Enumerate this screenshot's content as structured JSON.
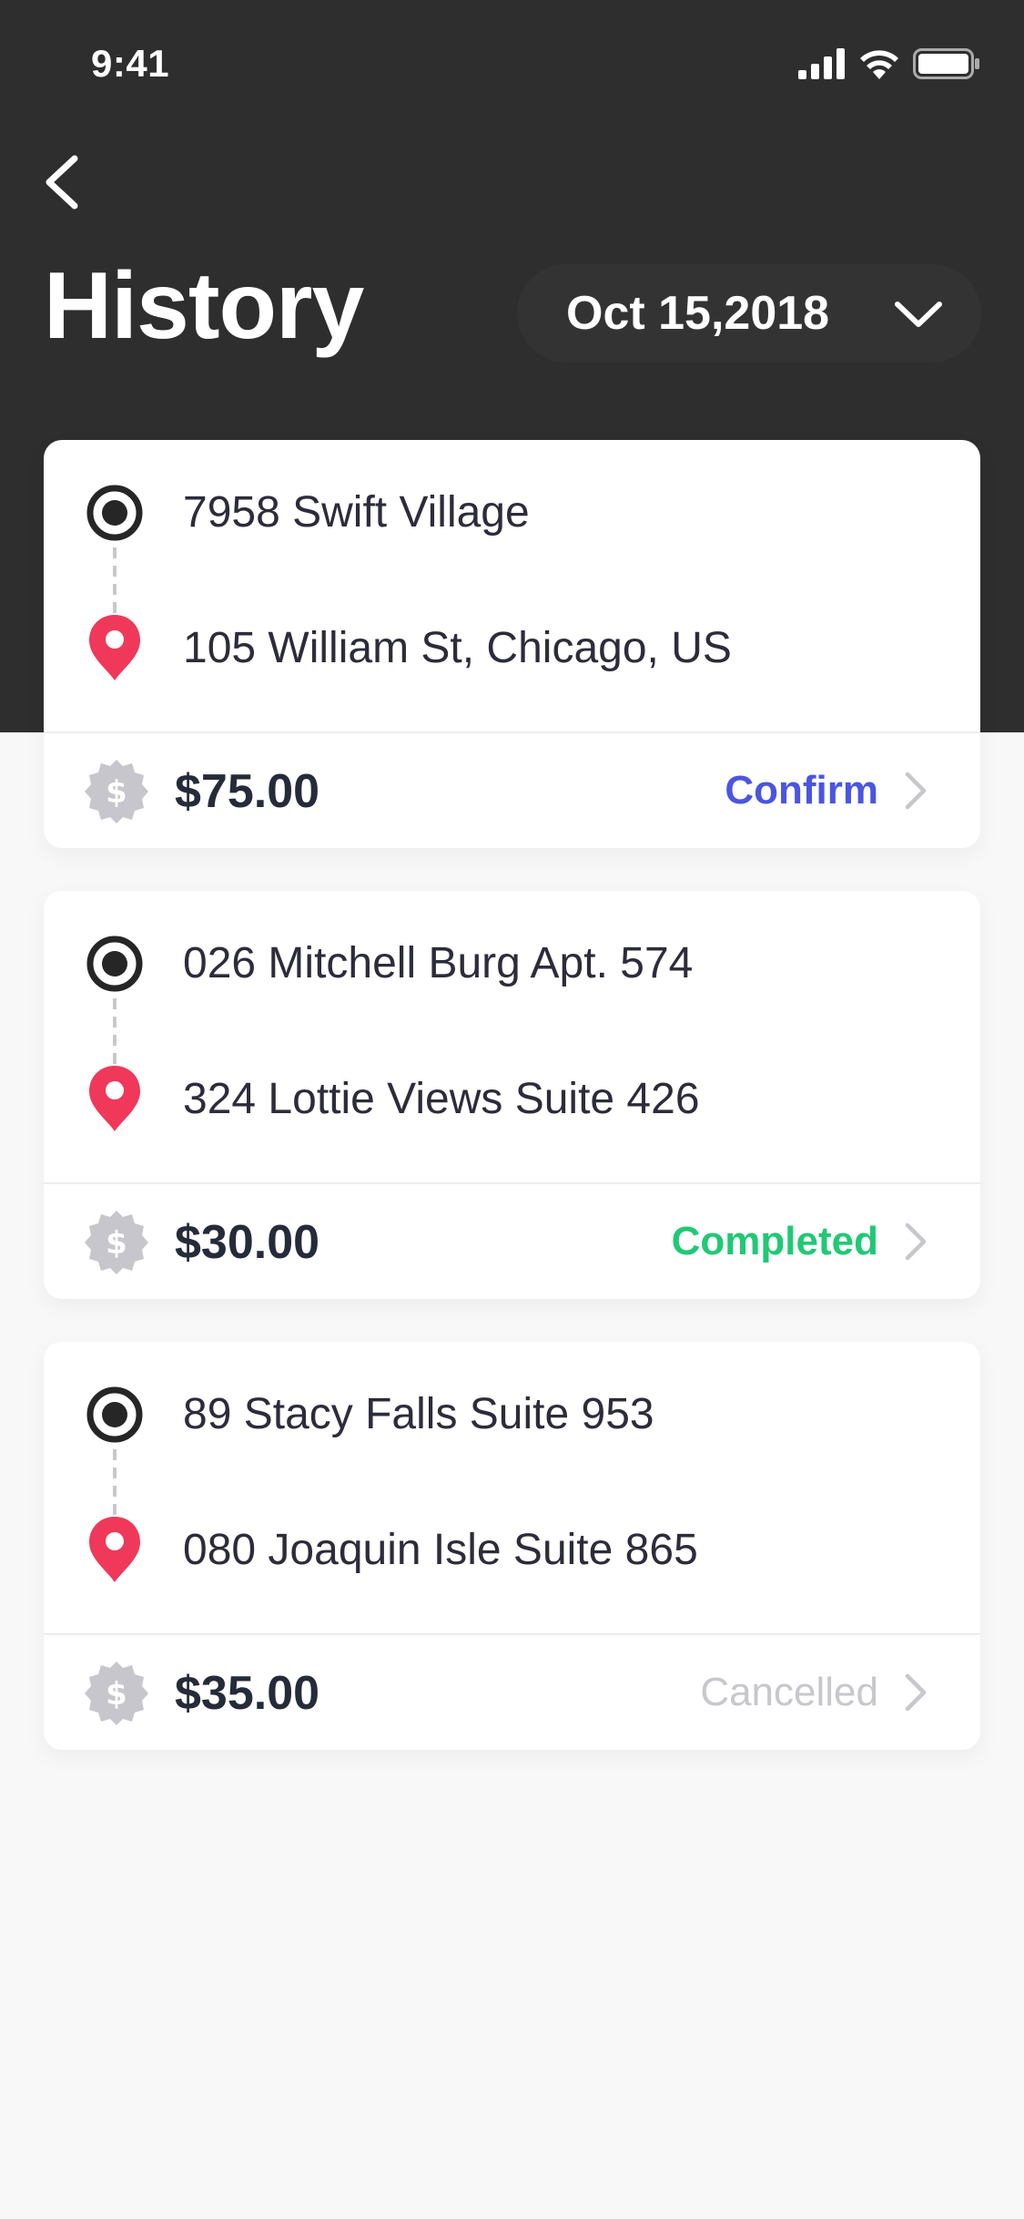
{
  "status_bar": {
    "time": "9:41"
  },
  "header": {
    "title": "History",
    "date_label": "Oct 15,2018"
  },
  "colors": {
    "header_bg": "#2e2e2e",
    "confirm": "#4b55e0",
    "completed": "#20c974",
    "cancelled": "#c7c7cc",
    "pin": "#f0385a"
  },
  "rides": [
    {
      "from": "7958 Swift Village",
      "to": "105 William St, Chicago, US",
      "price": "$75.00",
      "status": "Confirm",
      "status_color": "#4b55e0"
    },
    {
      "from": "026 Mitchell Burg Apt. 574",
      "to": "324 Lottie Views Suite 426",
      "price": "$30.00",
      "status": "Completed",
      "status_color": "#20c974"
    },
    {
      "from": "89 Stacy Falls Suite 953",
      "to": "080 Joaquin Isle Suite 865",
      "price": "$35.00",
      "status": "Cancelled",
      "status_color": "#c7c7cc"
    }
  ]
}
